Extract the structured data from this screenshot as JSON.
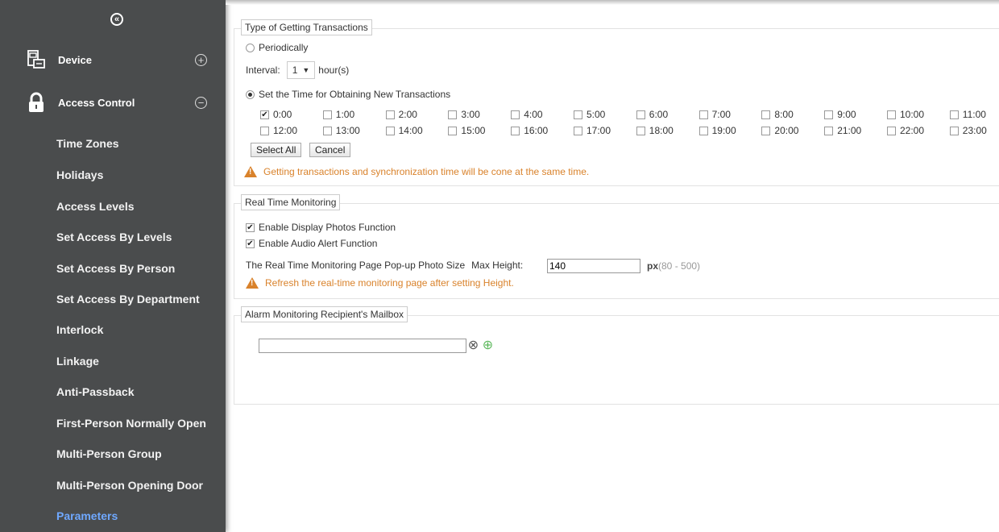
{
  "sidebar": {
    "modules": [
      {
        "label": "Device",
        "toggle": "+"
      },
      {
        "label": "Access Control",
        "toggle": "−"
      }
    ],
    "items": [
      "Time Zones",
      "Holidays",
      "Access Levels",
      "Set Access By Levels",
      "Set Access By Person",
      "Set Access By Department",
      "Interlock",
      "Linkage",
      "Anti-Passback",
      "First-Person Normally Open",
      "Multi-Person Group",
      "Multi-Person Opening Door",
      "Parameters"
    ]
  },
  "transactions": {
    "legend": "Type of Getting Transactions",
    "periodically_label": "Periodically",
    "interval_label": "Interval:",
    "interval_value": "1",
    "interval_unit": "hour(s)",
    "set_time_label": "Set the Time for Obtaining New Transactions",
    "hours": [
      "0:00",
      "1:00",
      "2:00",
      "3:00",
      "4:00",
      "5:00",
      "6:00",
      "7:00",
      "8:00",
      "9:00",
      "10:00",
      "11:00",
      "12:00",
      "13:00",
      "14:00",
      "15:00",
      "16:00",
      "17:00",
      "18:00",
      "19:00",
      "20:00",
      "21:00",
      "22:00",
      "23:00"
    ],
    "checked_hour": "0:00",
    "select_all_label": "Select All",
    "cancel_label": "Cancel",
    "warning": "Getting transactions and synchronization time will be cone at the same time."
  },
  "monitoring": {
    "legend": "Real Time Monitoring",
    "display_photos_label": "Enable Display Photos Function",
    "audio_alert_label": "Enable Audio Alert Function",
    "photo_size_label": "The Real Time Monitoring Page Pop-up Photo Size",
    "max_height_label": "Max Height:",
    "max_height_value": "140",
    "unit": "px",
    "range": "(80 - 500)",
    "warning": "Refresh the real-time monitoring page after setting Height."
  },
  "mailbox": {
    "legend": "Alarm Monitoring Recipient's Mailbox",
    "email_value": "",
    "remove_icon": "⊗",
    "add_icon": "⊕"
  },
  "colors": {
    "sidebar_bg": "#4a4c4d",
    "active_item": "#6fa8ff",
    "warning": "#d9822b",
    "add_green": "#5cb85c"
  },
  "icons": {
    "collapse": "«",
    "device": "device-icon",
    "access": "lock-icon"
  }
}
